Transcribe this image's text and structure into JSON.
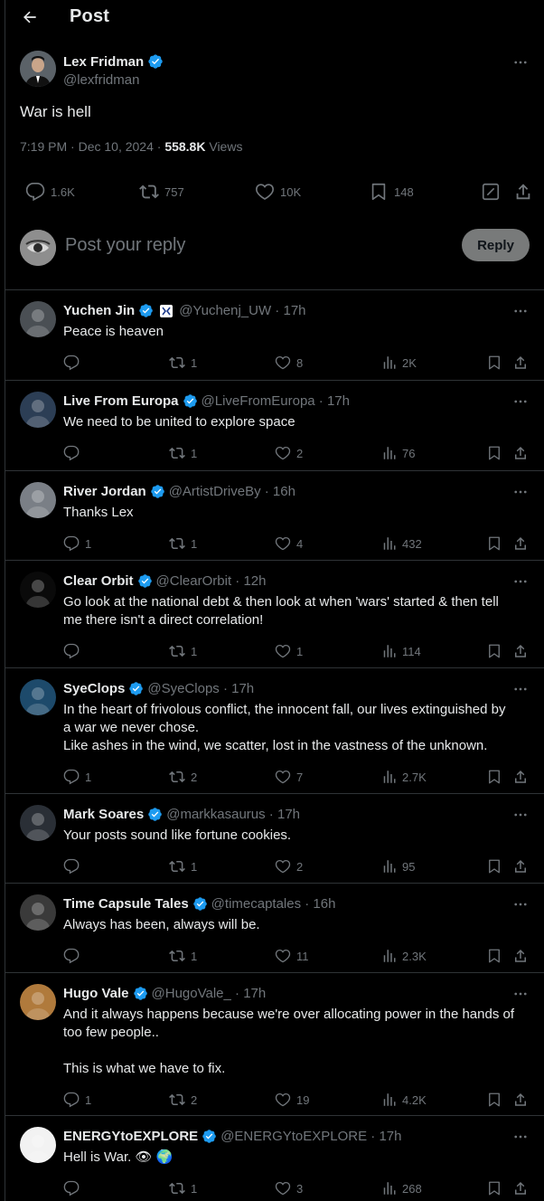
{
  "header": {
    "title": "Post"
  },
  "post": {
    "author": "Lex Fridman",
    "handle": "@lexfridman",
    "text": "War is hell",
    "time": "7:19 PM · Dec 10, 2024 · ",
    "views": "558.8K",
    "views_label": " Views",
    "replies": "1.6K",
    "reposts": "757",
    "likes": "10K",
    "bookmarks": "148"
  },
  "reply_box": {
    "placeholder": "Post your reply",
    "button": "Reply"
  },
  "replies": [
    {
      "name": "Yuchen Jin",
      "handle": "@Yuchenj_UW · 17h",
      "lines": [
        "Peace is heaven"
      ],
      "replies": "",
      "reposts": "1",
      "likes": "8",
      "views": "2K",
      "avatar_color": "#4a4f54"
    },
    {
      "name": "Live From Europa",
      "handle": "@LiveFromEuropa · 17h",
      "lines": [
        "We need to be united to explore space"
      ],
      "replies": "",
      "reposts": "1",
      "likes": "2",
      "views": "76",
      "avatar_color": "#2c3e55"
    },
    {
      "name": "River Jordan",
      "handle": "@ArtistDriveBy · 16h",
      "lines": [
        "Thanks Lex"
      ],
      "replies": "1",
      "reposts": "1",
      "likes": "4",
      "views": "432",
      "avatar_color": "#7a7f86"
    },
    {
      "name": "Clear Orbit",
      "handle": "@ClearOrbit · 12h",
      "lines": [
        "Go look at the national debt & then look at when 'wars' started & then tell",
        "me there isn't a direct correlation!"
      ],
      "replies": "",
      "reposts": "1",
      "likes": "1",
      "views": "114",
      "avatar_color": "#0a0a0a"
    },
    {
      "name": "SyeClops",
      "handle": "@SyeClops · 17h",
      "lines": [
        "In the heart of frivolous conflict, the innocent fall, our lives extinguished by",
        "a war we never chose.",
        "Like ashes in the wind, we scatter, lost in the vastness of the unknown."
      ],
      "replies": "1",
      "reposts": "2",
      "likes": "7",
      "views": "2.7K",
      "avatar_color": "#1d4a6b"
    },
    {
      "name": "Mark Soares",
      "handle": "@markkasaurus · 17h",
      "lines": [
        "Your posts sound like fortune cookies."
      ],
      "replies": "",
      "reposts": "1",
      "likes": "2",
      "views": "95",
      "avatar_color": "#2a2f36"
    },
    {
      "name": "Time Capsule Tales",
      "handle": "@timecaptales · 16h",
      "lines": [
        "Always has been, always will be."
      ],
      "replies": "",
      "reposts": "1",
      "likes": "11",
      "views": "2.3K",
      "avatar_color": "#3a3a3a"
    },
    {
      "name": "Hugo Vale",
      "handle": "@HugoVale_ · 17h",
      "lines": [
        "And it always happens because we're over allocating power in the hands of",
        "too few people..",
        "",
        "This is what we have to fix."
      ],
      "replies": "1",
      "reposts": "2",
      "likes": "19",
      "views": "4.2K",
      "avatar_color": "#b07a3c"
    },
    {
      "name": "ENERGYtoEXPLORE",
      "handle": "@ENERGYtoEXPLORE · 17h",
      "lines": [
        "Hell is War. 👁 🌍"
      ],
      "replies": "",
      "reposts": "1",
      "likes": "3",
      "views": "268",
      "avatar_color": "#f2f2f2"
    }
  ],
  "colors": {
    "accent": "#1d9bf0",
    "muted": "#71767b",
    "border": "#2f3336"
  }
}
